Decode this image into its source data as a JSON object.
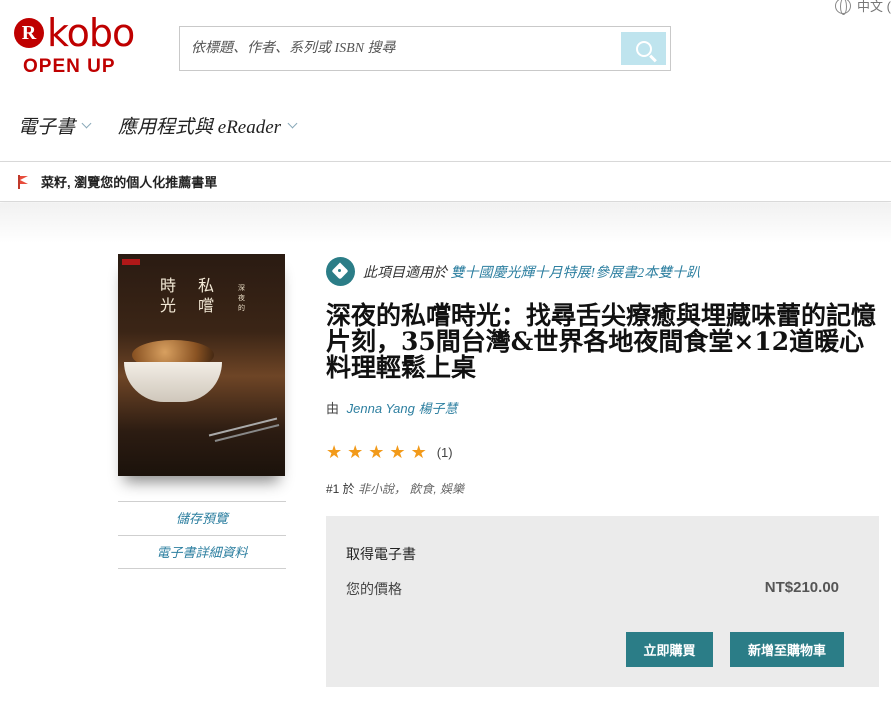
{
  "header": {
    "logo_text": "kobo",
    "logo_r": "R",
    "logo_sub": "OPEN UP",
    "language": "中文 (",
    "search_placeholder": "依標題、作者、系列或 ISBN 搜尋"
  },
  "nav": {
    "items": [
      {
        "label": "電子書"
      },
      {
        "label": "應用程式與 eReader"
      }
    ]
  },
  "recommend_bar": {
    "text": "菜籽, 瀏覽您的個人化推薦書單"
  },
  "cover": {
    "title_col1": "時光",
    "title_col2": "私嚐",
    "title_col3": "深夜的"
  },
  "side_links": [
    {
      "label": "儲存預覽"
    },
    {
      "label": "電子書詳細資料"
    }
  ],
  "promo": {
    "prefix": "此項目適用於",
    "link": "雙十國慶光輝十月特展!參展書2本雙十趴"
  },
  "book": {
    "title": "深夜的私嚐時光：找尋舌尖療癒與埋藏味蕾的記憶片刻，35間台灣&世界各地夜間食堂×12道暖心料理輕鬆上桌",
    "author_prefix": "由",
    "author": "Jenna Yang 楊子慧",
    "rating": 5,
    "rating_count": "(1)",
    "rank": "#1 於",
    "categories": "非小說， 飲食, 娛樂"
  },
  "buy": {
    "heading": "取得電子書",
    "price_label": "您的價格",
    "price": "NT$210.00",
    "buy_now": "立即購買",
    "add_to_cart": "新增至購物車"
  },
  "colors": {
    "brand": "#bf0000",
    "accent": "#2b7d87",
    "link": "#2d7fa0",
    "star": "#f29a1a"
  }
}
